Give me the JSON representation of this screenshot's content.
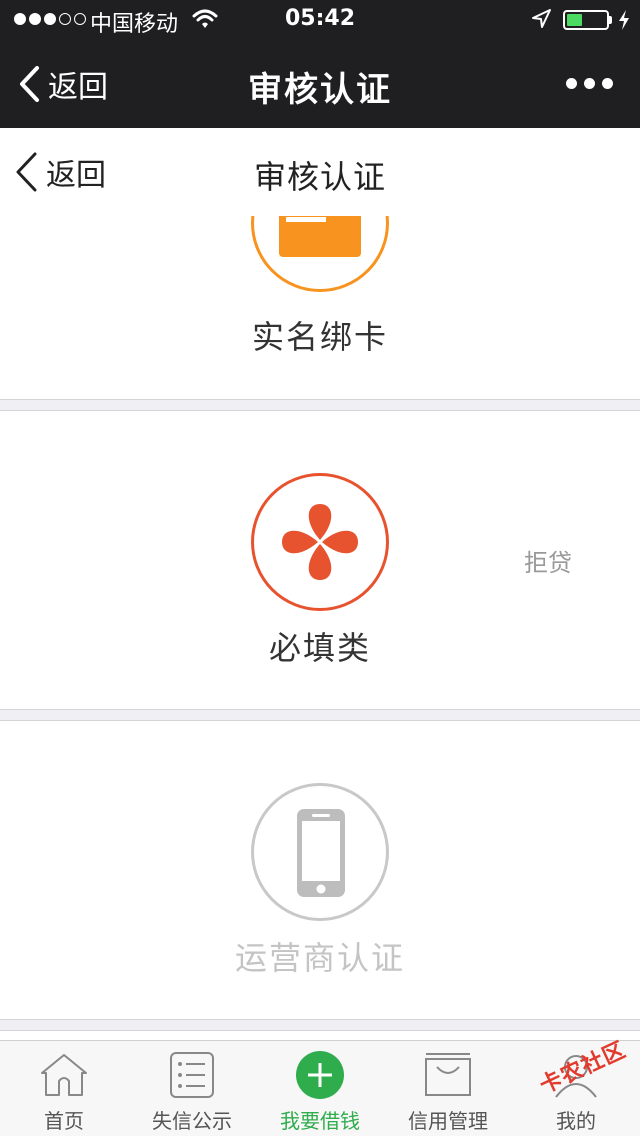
{
  "status_bar": {
    "carrier": "中国移动",
    "time": "05:42",
    "battery_level": 0.4,
    "signal_bars": 3,
    "signal_total": 5
  },
  "nav_bar": {
    "back_label": "返回",
    "title": "审核认证",
    "more_icon": "more-icon"
  },
  "page_header": {
    "back_label": "返回",
    "title": "审核认证"
  },
  "sections": [
    {
      "label": "实名绑卡",
      "icon": "bank-card-icon",
      "color": "#f7931e",
      "status": ""
    },
    {
      "label": "必填类",
      "icon": "four-petal-icon",
      "color": "#e8532f",
      "status": "拒贷"
    },
    {
      "label": "运营商认证",
      "icon": "phone-icon",
      "color": "#c8c8c8",
      "status": ""
    }
  ],
  "tab_bar": {
    "items": [
      {
        "label": "首页",
        "icon": "home-icon",
        "active": false
      },
      {
        "label": "失信公示",
        "icon": "list-icon",
        "active": false
      },
      {
        "label": "我要借钱",
        "icon": "plus-circle-icon",
        "active": true
      },
      {
        "label": "信用管理",
        "icon": "bag-icon",
        "active": false
      },
      {
        "label": "我的",
        "icon": "user-icon",
        "active": false
      }
    ],
    "active_color": "#2fac4c"
  },
  "watermark": "卡农社区"
}
